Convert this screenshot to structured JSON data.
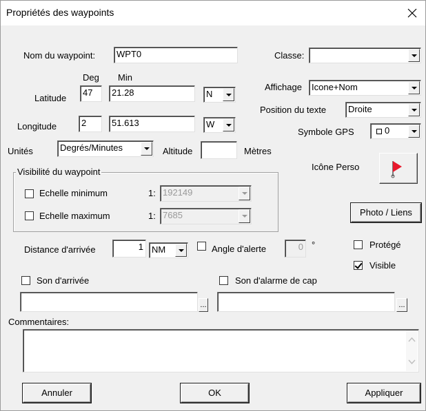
{
  "window": {
    "title": "Propriétés des waypoints"
  },
  "name_label": "Nom du waypoint:",
  "name_value": "WPT0",
  "classe_label": "Classe:",
  "classe_value": "",
  "deg_header": "Deg",
  "min_header": "Min",
  "latitude_label": "Latitude",
  "latitude_deg": "47",
  "latitude_min": "21.28",
  "latitude_hemi": "N",
  "longitude_label": "Longitude",
  "longitude_deg": "2",
  "longitude_min": "51.613",
  "longitude_hemi": "W",
  "affichage_label": "Affichage",
  "affichage_value": "Icone+Nom",
  "position_texte_label": "Position du texte",
  "position_texte_value": "Droite",
  "symbole_gps_label": "Symbole GPS",
  "symbole_gps_value": "0",
  "unites_label": "Unités",
  "unites_value": "Degrés/Minutes",
  "altitude_label": "Altitude",
  "altitude_value": "",
  "altitude_unit": "Mètres",
  "icone_perso_label": "Icône Perso",
  "visibility_group_label": "Visibilité du waypoint",
  "echelle_min_label": "Echelle minimum",
  "echelle_min_prefix": "1:",
  "echelle_min_value": "192149",
  "echelle_max_label": "Echelle maximum",
  "echelle_max_prefix": "1:",
  "echelle_max_value": "7685",
  "photo_liens_label": "Photo / Liens",
  "distance_label": "Distance d'arrivée",
  "distance_value": "1",
  "distance_unit": "NM",
  "angle_label": "Angle d'alerte",
  "angle_value": "0",
  "angle_unit": "°",
  "protege_label": "Protégé",
  "visible_label": "Visible",
  "visible_checked": true,
  "son_arrivee_label": "Son d'arrivée",
  "son_alarme_label": "Son d'alarme de cap",
  "ellipsis_label": "...",
  "commentaires_label": "Commentaires:",
  "annuler_label": "Annuler",
  "ok_label": "OK",
  "appliquer_label": "Appliquer",
  "colors": {
    "flag_red": "#e8192c",
    "dialog_bg": "#f0f0f0"
  }
}
